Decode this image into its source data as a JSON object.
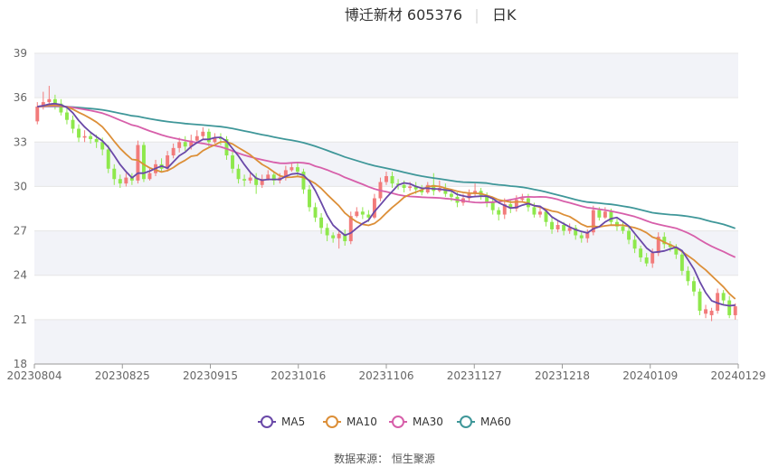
{
  "header": {
    "title": "博迁新材 605376",
    "period": "日K"
  },
  "source_text": "数据来源： 恒生聚源",
  "colors": {
    "up": "#f27b7b",
    "down": "#8ee84c",
    "band": "#f2f3f8",
    "grid": "#e6e6e6",
    "ma5": "#6a49a8",
    "ma10": "#dc8f38",
    "ma30": "#d75faa",
    "ma60": "#3f9799"
  },
  "chart_data": {
    "type": "candlestick",
    "title": "博迁新材 605376 日K",
    "ylim": [
      18,
      39
    ],
    "y_ticks": [
      18,
      21,
      24,
      27,
      30,
      33,
      36,
      39
    ],
    "x_tick_labels": [
      "20230804",
      "20230825",
      "20230915",
      "20231016",
      "20231106",
      "20231127",
      "20231218",
      "20240109",
      "20240129"
    ],
    "legend": [
      "MA5",
      "MA10",
      "MA30",
      "MA60"
    ],
    "candles": [
      [
        34.4,
        35.4,
        35.7,
        34.2
      ],
      [
        35.4,
        35.7,
        36.4,
        35.2
      ],
      [
        35.7,
        35.9,
        36.8,
        35.5
      ],
      [
        35.9,
        35.6,
        36.2,
        35.2
      ],
      [
        35.6,
        35.0,
        35.9,
        34.8
      ],
      [
        35.0,
        34.5,
        35.3,
        34.2
      ],
      [
        34.5,
        33.9,
        34.8,
        33.6
      ],
      [
        33.9,
        33.3,
        34.2,
        33.0
      ],
      [
        33.3,
        33.4,
        33.8,
        33.0
      ],
      [
        33.4,
        33.2,
        33.7,
        32.9
      ],
      [
        33.2,
        33.0,
        33.5,
        32.6
      ],
      [
        33.0,
        32.5,
        33.3,
        32.1
      ],
      [
        32.5,
        31.2,
        32.8,
        30.9
      ],
      [
        31.2,
        30.5,
        31.5,
        30.1
      ],
      [
        30.5,
        30.2,
        30.8,
        29.9
      ],
      [
        30.2,
        30.6,
        30.9,
        30.0
      ],
      [
        30.6,
        30.4,
        30.9,
        30.1
      ],
      [
        30.4,
        32.8,
        33.1,
        30.2
      ],
      [
        32.8,
        30.5,
        33.0,
        30.3
      ],
      [
        30.5,
        30.9,
        31.2,
        30.4
      ],
      [
        30.9,
        31.5,
        31.8,
        30.7
      ],
      [
        31.5,
        31.2,
        31.9,
        31.0
      ],
      [
        31.2,
        32.1,
        32.4,
        31.0
      ],
      [
        32.1,
        32.6,
        32.9,
        31.9
      ],
      [
        32.6,
        33.0,
        33.3,
        32.3
      ],
      [
        33.0,
        32.7,
        33.4,
        32.4
      ],
      [
        32.7,
        33.1,
        33.5,
        32.5
      ],
      [
        33.1,
        33.4,
        33.8,
        33.0
      ],
      [
        33.4,
        33.7,
        34.0,
        33.2
      ],
      [
        33.7,
        33.0,
        33.9,
        32.7
      ],
      [
        33.0,
        33.3,
        33.6,
        32.9
      ],
      [
        33.3,
        33.2,
        33.6,
        32.8
      ],
      [
        33.2,
        32.1,
        33.4,
        31.8
      ],
      [
        32.1,
        31.2,
        32.4,
        30.9
      ],
      [
        31.2,
        30.5,
        31.5,
        30.2
      ],
      [
        30.5,
        30.4,
        30.8,
        30.0
      ],
      [
        30.4,
        30.6,
        30.9,
        30.2
      ],
      [
        30.6,
        30.1,
        30.9,
        29.5
      ],
      [
        30.1,
        30.5,
        30.8,
        29.9
      ],
      [
        30.5,
        30.8,
        31.1,
        30.4
      ],
      [
        30.8,
        30.4,
        31.0,
        30.1
      ],
      [
        30.4,
        30.6,
        30.9,
        30.2
      ],
      [
        30.6,
        31.1,
        31.4,
        30.4
      ],
      [
        31.1,
        31.3,
        31.6,
        31.0
      ],
      [
        31.3,
        31.0,
        31.6,
        30.7
      ],
      [
        31.0,
        29.8,
        31.2,
        29.5
      ],
      [
        29.8,
        28.6,
        30.1,
        28.3
      ],
      [
        28.6,
        27.9,
        28.9,
        27.6
      ],
      [
        27.9,
        27.2,
        28.2,
        26.8
      ],
      [
        27.2,
        26.7,
        27.5,
        26.3
      ],
      [
        26.7,
        26.5,
        26.9,
        26.2
      ],
      [
        26.5,
        26.8,
        27.0,
        25.8
      ],
      [
        26.8,
        26.3,
        27.1,
        26.0
      ],
      [
        26.3,
        28.0,
        28.3,
        26.1
      ],
      [
        28.0,
        28.3,
        28.6,
        27.9
      ],
      [
        28.3,
        28.1,
        28.6,
        27.8
      ],
      [
        28.1,
        27.9,
        28.4,
        27.6
      ],
      [
        27.9,
        29.2,
        29.5,
        27.8
      ],
      [
        29.2,
        30.3,
        30.6,
        29.0
      ],
      [
        30.3,
        30.7,
        31.0,
        30.1
      ],
      [
        30.7,
        30.2,
        31.0,
        29.9
      ],
      [
        30.2,
        30.1,
        30.5,
        29.8
      ],
      [
        30.1,
        29.9,
        30.4,
        29.6
      ],
      [
        29.9,
        30.0,
        30.3,
        29.7
      ],
      [
        30.0,
        29.8,
        30.3,
        29.5
      ],
      [
        29.8,
        29.6,
        30.1,
        29.4
      ],
      [
        29.6,
        30.1,
        30.3,
        29.5
      ],
      [
        30.1,
        29.7,
        30.9,
        29.4
      ],
      [
        29.7,
        29.9,
        30.4,
        29.6
      ],
      [
        29.9,
        29.5,
        30.2,
        29.3
      ],
      [
        29.5,
        29.3,
        29.8,
        29.0
      ],
      [
        29.3,
        28.9,
        29.6,
        28.6
      ],
      [
        28.9,
        29.2,
        29.5,
        28.7
      ],
      [
        29.2,
        29.5,
        29.8,
        29.0
      ],
      [
        29.5,
        29.7,
        30.2,
        29.3
      ],
      [
        29.7,
        29.4,
        29.9,
        29.1
      ],
      [
        29.4,
        28.9,
        29.6,
        28.6
      ],
      [
        28.9,
        28.4,
        29.2,
        28.1
      ],
      [
        28.4,
        28.1,
        28.6,
        27.7
      ],
      [
        28.1,
        28.8,
        29.2,
        27.8
      ],
      [
        28.8,
        28.5,
        29.1,
        28.2
      ],
      [
        28.5,
        29.1,
        29.4,
        28.3
      ],
      [
        29.1,
        29.2,
        29.5,
        28.9
      ],
      [
        29.2,
        28.6,
        29.5,
        28.3
      ],
      [
        28.6,
        28.1,
        28.9,
        27.9
      ],
      [
        28.1,
        28.3,
        28.6,
        27.9
      ],
      [
        28.3,
        27.6,
        28.5,
        27.3
      ],
      [
        27.6,
        27.1,
        27.9,
        26.8
      ],
      [
        27.1,
        27.4,
        27.7,
        26.9
      ],
      [
        27.4,
        27.0,
        27.6,
        26.7
      ],
      [
        27.0,
        27.2,
        27.5,
        26.8
      ],
      [
        27.2,
        26.7,
        27.4,
        26.4
      ],
      [
        26.7,
        26.5,
        26.9,
        26.2
      ],
      [
        26.5,
        26.9,
        27.1,
        26.2
      ],
      [
        26.9,
        28.4,
        28.7,
        26.7
      ],
      [
        28.4,
        27.9,
        28.6,
        27.7
      ],
      [
        27.9,
        28.3,
        28.6,
        27.8
      ],
      [
        28.3,
        27.6,
        28.5,
        27.4
      ],
      [
        27.6,
        27.3,
        27.9,
        27.0
      ],
      [
        27.3,
        27.0,
        27.6,
        26.8
      ],
      [
        27.0,
        26.4,
        27.3,
        26.1
      ],
      [
        26.4,
        25.8,
        26.7,
        25.5
      ],
      [
        25.8,
        25.2,
        26.0,
        24.9
      ],
      [
        25.2,
        24.8,
        25.5,
        24.6
      ],
      [
        24.8,
        25.5,
        25.8,
        24.5
      ],
      [
        25.5,
        26.6,
        26.9,
        25.3
      ],
      [
        26.6,
        26.1,
        26.9,
        25.8
      ],
      [
        26.1,
        25.9,
        26.3,
        25.6
      ],
      [
        25.9,
        25.4,
        26.1,
        25.1
      ],
      [
        25.4,
        24.3,
        25.7,
        24.0
      ],
      [
        24.3,
        23.6,
        24.6,
        23.3
      ],
      [
        23.6,
        22.9,
        23.9,
        22.6
      ],
      [
        22.9,
        21.6,
        23.1,
        21.3
      ],
      [
        21.4,
        21.7,
        22.0,
        21.1
      ],
      [
        21.3,
        21.6,
        21.8,
        20.9
      ],
      [
        21.6,
        22.8,
        23.1,
        21.4
      ],
      [
        22.8,
        22.3,
        23.0,
        22.0
      ],
      [
        22.3,
        21.3,
        22.6,
        21.1
      ],
      [
        21.3,
        21.9,
        22.1,
        21.0
      ]
    ]
  }
}
